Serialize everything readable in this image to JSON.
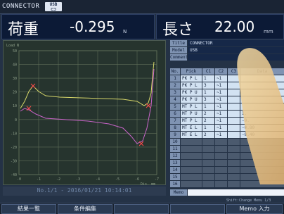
{
  "app": {
    "title": "CONNECTOR",
    "usb_badge": "USB"
  },
  "readouts": {
    "load_label": "荷重",
    "load_value": "-0.295",
    "load_unit": "N",
    "length_label": "長さ",
    "length_value": "22.00",
    "length_unit": "mm"
  },
  "graph": {
    "ylabel": "Load N",
    "xlabel": "Dis. mm",
    "yticks": [
      "50",
      "40",
      "30",
      "20",
      "10",
      "0",
      "-10",
      "-20",
      "-30",
      "-40"
    ],
    "xticks": [
      "-0",
      "-1",
      "-2",
      "-3",
      "-4",
      "-5",
      "-6",
      "-7"
    ],
    "footer": "No.1/1 - 2016/01/21 10:14:01",
    "colors": {
      "grid": "#5f6e58",
      "series_a": "#d8d86a",
      "series_b": "#c864c8",
      "marker": "#ff4a4a"
    }
  },
  "meta": [
    {
      "key": "Title",
      "value": "CONNECTOR"
    },
    {
      "key": "Model",
      "value": "USB"
    },
    {
      "key": "Comment",
      "value": ""
    }
  ],
  "table": {
    "headers": [
      "No.",
      "Pick",
      "C1",
      "C2",
      "C3",
      "Data"
    ],
    "rows": [
      {
        "no": "1",
        "pick": "PK P L",
        "c1": "1",
        "c2": "~1",
        "c3": "",
        "data": ""
      },
      {
        "no": "2",
        "pick": "PK P L",
        "c1": "3",
        "c2": "~1",
        "c3": "",
        "data": ""
      },
      {
        "no": "3",
        "pick": "PK P U",
        "c1": "1",
        "c2": "~1",
        "c3": "",
        "data": ""
      },
      {
        "no": "4",
        "pick": "PK P U",
        "c1": "3",
        "c2": "~1",
        "c3": "",
        "data": ""
      },
      {
        "no": "5",
        "pick": "MT P L",
        "c1": "1",
        "c2": "~1",
        "c3": "",
        "data": ""
      },
      {
        "no": "6",
        "pick": "MT P U",
        "c1": "2",
        "c2": "~1",
        "c3": "",
        "data": "1."
      },
      {
        "no": "7",
        "pick": "MT P L",
        "c1": "2",
        "c2": "~1",
        "c3": "",
        "data": "-0."
      },
      {
        "no": "8",
        "pick": "MT E L",
        "c1": "1",
        "c2": "~1",
        "c3": "",
        "data": "-0.80"
      },
      {
        "no": "9",
        "pick": "MT E L",
        "c1": "2",
        "c2": "~1",
        "c3": "",
        "data": "-0.40"
      },
      {
        "no": "10"
      },
      {
        "no": "11"
      },
      {
        "no": "12"
      },
      {
        "no": "13"
      },
      {
        "no": "14"
      },
      {
        "no": "15"
      },
      {
        "no": "16"
      }
    ]
  },
  "memo": {
    "label": "Memo",
    "value": ""
  },
  "shift_note": "Shift:Change Menu 1/3",
  "softkeys": [
    "結果一覧",
    "条件編集",
    "",
    "",
    "Memo 入力"
  ]
}
